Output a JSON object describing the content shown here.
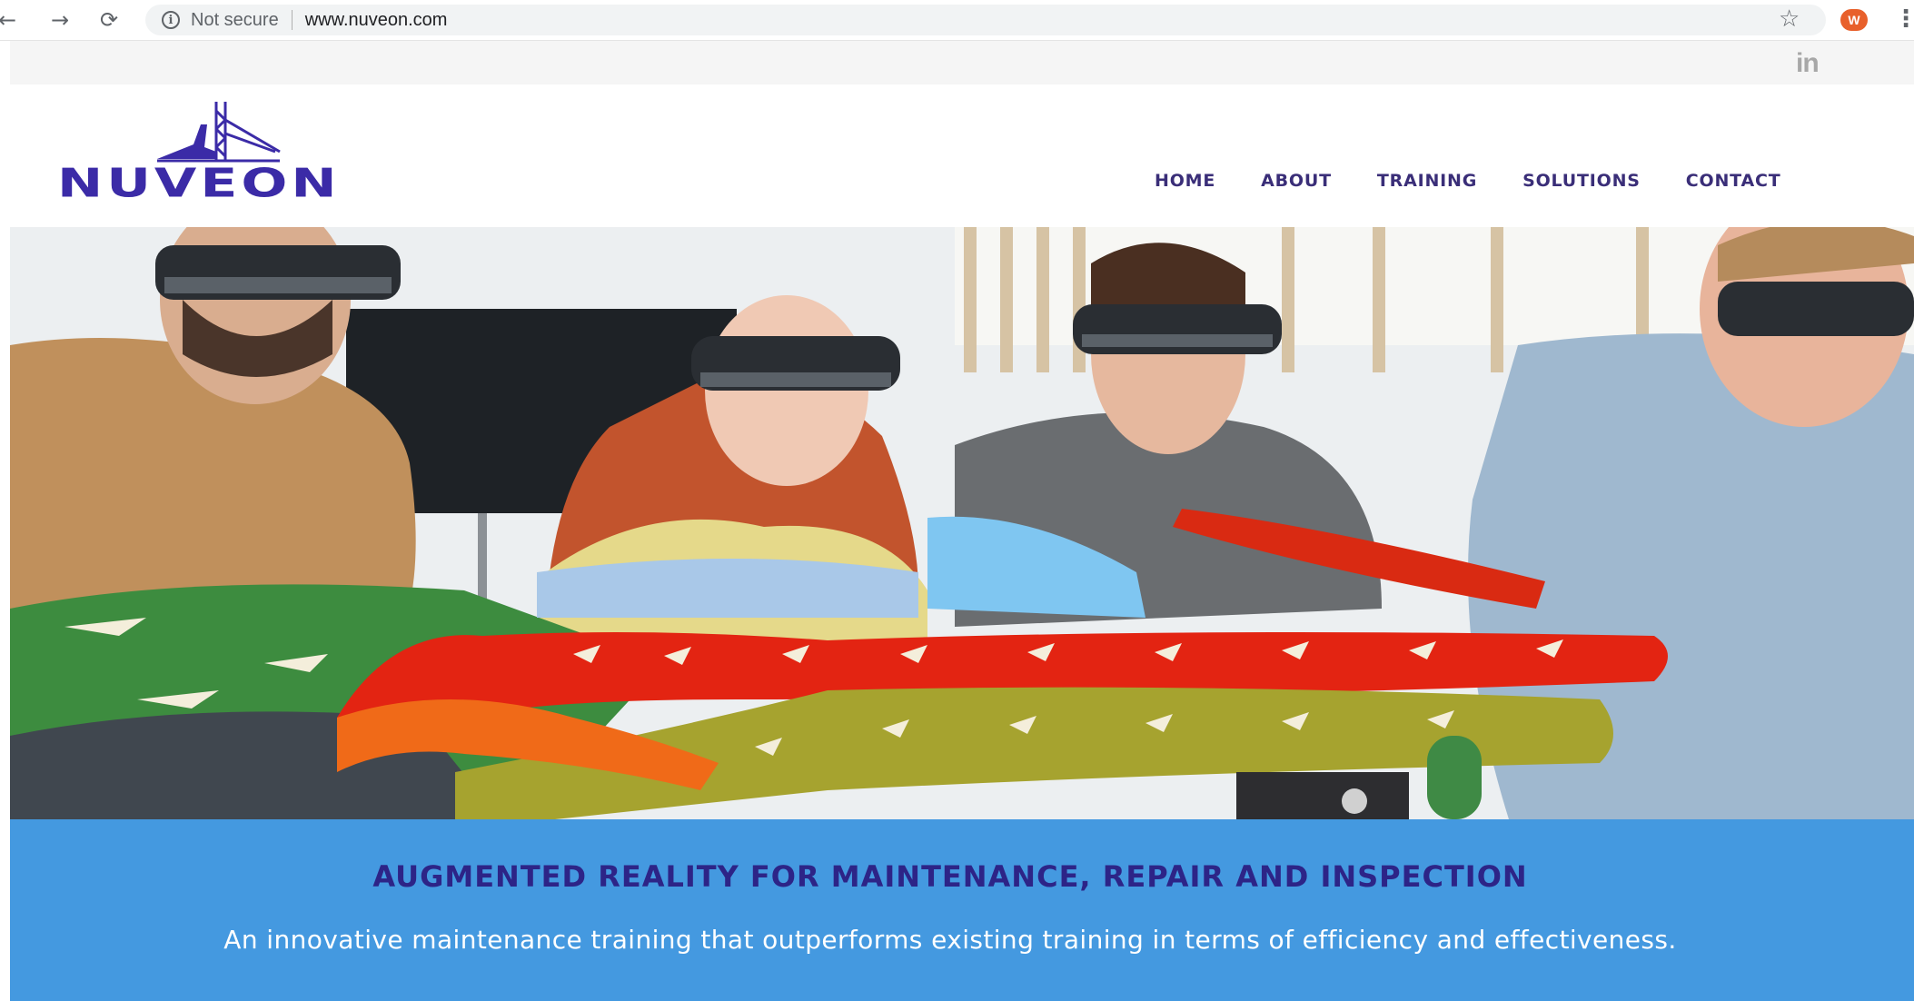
{
  "browser": {
    "nav": {
      "back": "←",
      "forward": "→",
      "reload": "⟳"
    },
    "security_text": "Not secure",
    "url": "www.nuveon.com",
    "avatar_letter": "W",
    "icons": [
      "back-arrow-icon",
      "forward-arrow-icon",
      "reload-icon",
      "info-icon",
      "star-icon",
      "profile-avatar",
      "menu-dots-icon"
    ]
  },
  "social": {
    "linkedin_label": "in"
  },
  "site": {
    "logo_text": "NUVEON",
    "nav": [
      "HOME",
      "ABOUT",
      "TRAINING",
      "SOLUTIONS",
      "CONTACT"
    ]
  },
  "banner": {
    "headline": "AUGMENTED REALITY FOR MAINTENANCE, REPAIR AND INSPECTION",
    "tagline": "An innovative maintenance training that outperforms existing training in terms of efficiency and effectiveness."
  },
  "colors": {
    "brand_purple": "#3b2ba7",
    "nav_text": "#3a2e78",
    "banner_bg": "#4499e0",
    "headline": "#2d2487"
  }
}
